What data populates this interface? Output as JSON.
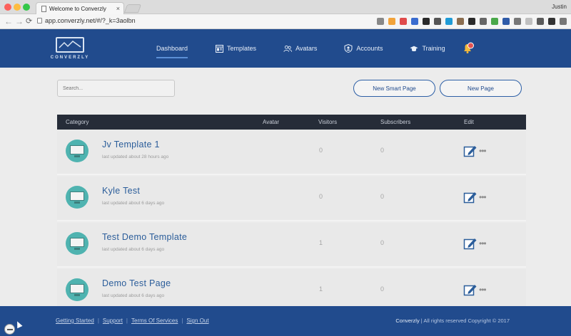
{
  "browser": {
    "tab_title": "Welcome to Converzly",
    "tab_close": "×",
    "user": "Justin",
    "url": "app.converzly.net/#/?_k=3aolbn",
    "extension_colors": [
      "#888",
      "#f2a33a",
      "#e04b4b",
      "#3a6ccf",
      "#2a2a2a",
      "#555",
      "#1f9bd6",
      "#8b6d4f",
      "#2a2a2a",
      "#666",
      "#4aa84a",
      "#2f5ba8",
      "#777",
      "#c0c0c0",
      "#5a5a5a",
      "#333",
      "#777"
    ]
  },
  "header": {
    "logo_text": "CONVERZLY",
    "nav": [
      {
        "label": "Dashboard",
        "icon": "none"
      },
      {
        "label": "Templates",
        "icon": "templates-icon"
      },
      {
        "label": "Avatars",
        "icon": "avatars-icon"
      },
      {
        "label": "Accounts",
        "icon": "accounts-icon"
      },
      {
        "label": "Training",
        "icon": "graduation-cap-icon"
      }
    ],
    "bell_badge_color": "#e35252",
    "brand_color": "#214b8d"
  },
  "controls": {
    "search_placeholder": "Search...",
    "new_smart_page": "New Smart Page",
    "new_page": "New Page"
  },
  "table": {
    "headers": {
      "category": "Category",
      "avatar": "Avatar",
      "visitors": "Visitors",
      "subscribers": "Subscribers",
      "edit": "Edit"
    },
    "rows": [
      {
        "title": "Jv Template 1",
        "updated": "last updated about 28 hours ago",
        "visitors": "0",
        "subscribers": "0"
      },
      {
        "title": "Kyle Test",
        "updated": "last updated about 6 days ago",
        "visitors": "0",
        "subscribers": "0"
      },
      {
        "title": "Test Demo Template",
        "updated": "last updated about 6 days ago",
        "visitors": "1",
        "subscribers": "0"
      },
      {
        "title": "Demo Test Page",
        "updated": "last updated about 6 days ago",
        "visitors": "1",
        "subscribers": "0"
      }
    ],
    "more_glyph": "•••"
  },
  "footer": {
    "links": [
      "Getting Started",
      "Support",
      "Terms Of Services",
      "Sign Out"
    ],
    "brand": "Converzly",
    "copyright": "| All rights reserved Copyright © 2017"
  }
}
